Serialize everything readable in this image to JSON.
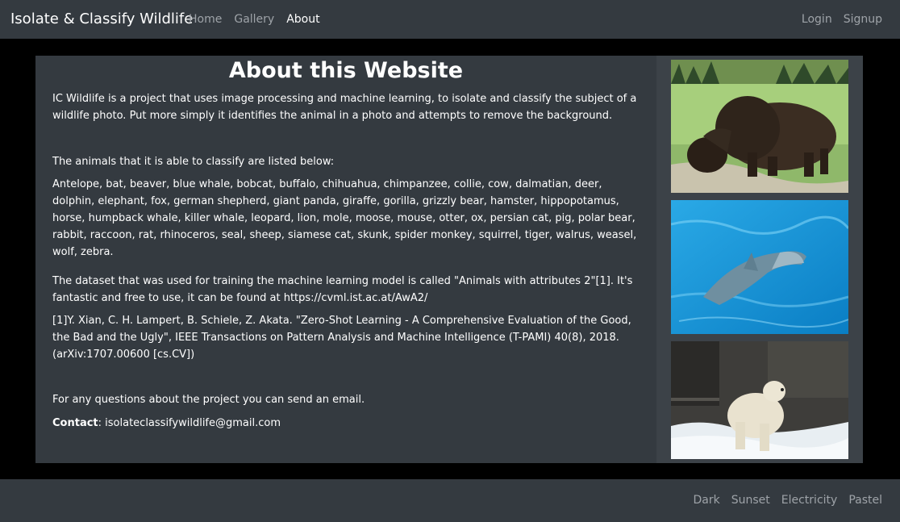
{
  "navbar": {
    "brand": "Isolate & Classify Wildlife",
    "links": [
      {
        "label": "Home"
      },
      {
        "label": "Gallery"
      },
      {
        "label": "About"
      }
    ],
    "right_links": [
      {
        "label": "Login"
      },
      {
        "label": "Signup"
      }
    ]
  },
  "main": {
    "title": "About this Website",
    "intro": "IC Wildlife is a project that uses image processing and machine learning, to isolate and classify the subject of a wildlife photo. Put more simply it identifies the animal in a photo and attempts to remove the background.",
    "animals_heading": "The animals that it is able to classify are listed below:",
    "animals_list": "Antelope, bat, beaver, blue whale, bobcat, buffalo, chihuahua, chimpanzee, collie, cow, dalmatian, deer, dolphin, elephant, fox, german shepherd, giant panda, giraffe, gorilla, grizzly bear, hamster, hippopotamus, horse, humpback whale, killer whale, leopard, lion, mole, moose, mouse, otter, ox, persian cat, pig, polar bear, rabbit, raccoon, rat, rhinoceros, seal, sheep, siamese cat, skunk, spider monkey, squirrel, tiger, walrus, weasel, wolf, zebra.",
    "dataset": "The dataset that was used for training the machine learning model is called \"Animals with attributes 2\"[1]. It's fantastic and free to use, it can be found at https://cvml.ist.ac.at/AwA2/",
    "citation": "[1]Y. Xian, C. H. Lampert, B. Schiele, Z. Akata. \"Zero-Shot Learning - A Comprehensive Evaluation of the Good, the Bad and the Ugly\", IEEE Transactions on Pattern Analysis and Machine Intelligence (T-PAMI) 40(8), 2018. (arXiv:1707.00600 [cs.CV])",
    "questions": "For any questions about the project you can send an email.",
    "contact_label": "Contact",
    "contact_email": "isolateclassifywildlife@gmail.com"
  },
  "sidebar": {
    "photos": [
      {
        "subject": "bison"
      },
      {
        "subject": "dolphin"
      },
      {
        "subject": "polar-bear"
      }
    ]
  },
  "footer": {
    "themes": [
      {
        "label": "Dark"
      },
      {
        "label": "Sunset"
      },
      {
        "label": "Electricity"
      },
      {
        "label": "Pastel"
      }
    ]
  },
  "colors": {
    "navbar_bg": "#343a40",
    "content_bg": "#343a40",
    "sidebar_bg": "#3c4248",
    "page_bg": "#000000",
    "link_muted": "#9ea3a8",
    "text": "#ffffff"
  }
}
